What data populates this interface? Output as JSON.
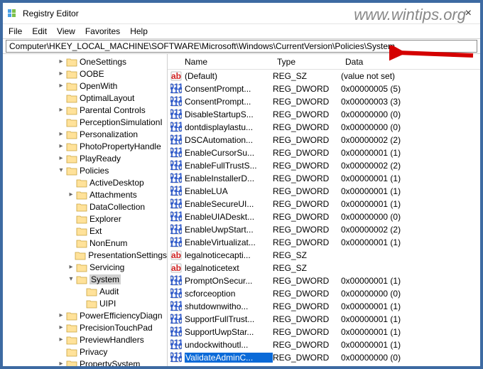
{
  "window": {
    "title": "Registry Editor",
    "watermark": "www.wintips.org"
  },
  "menu": {
    "file": "File",
    "edit": "Edit",
    "view": "View",
    "favorites": "Favorites",
    "help": "Help"
  },
  "address": {
    "value": "Computer\\HKEY_LOCAL_MACHINE\\SOFTWARE\\Microsoft\\Windows\\CurrentVersion\\Policies\\System"
  },
  "tree": {
    "items": [
      {
        "indent": 5,
        "twisty": ">",
        "label": "OneSettings"
      },
      {
        "indent": 5,
        "twisty": ">",
        "label": "OOBE"
      },
      {
        "indent": 5,
        "twisty": ">",
        "label": "OpenWith"
      },
      {
        "indent": 5,
        "twisty": "",
        "label": "OptimalLayout"
      },
      {
        "indent": 5,
        "twisty": ">",
        "label": "Parental Controls"
      },
      {
        "indent": 5,
        "twisty": "",
        "label": "PerceptionSimulationI"
      },
      {
        "indent": 5,
        "twisty": ">",
        "label": "Personalization"
      },
      {
        "indent": 5,
        "twisty": ">",
        "label": "PhotoPropertyHandle"
      },
      {
        "indent": 5,
        "twisty": ">",
        "label": "PlayReady"
      },
      {
        "indent": 5,
        "twisty": "v",
        "label": "Policies"
      },
      {
        "indent": 6,
        "twisty": "",
        "label": "ActiveDesktop"
      },
      {
        "indent": 6,
        "twisty": ">",
        "label": "Attachments"
      },
      {
        "indent": 6,
        "twisty": "",
        "label": "DataCollection"
      },
      {
        "indent": 6,
        "twisty": "",
        "label": "Explorer"
      },
      {
        "indent": 6,
        "twisty": "",
        "label": "Ext"
      },
      {
        "indent": 6,
        "twisty": "",
        "label": "NonEnum"
      },
      {
        "indent": 6,
        "twisty": "",
        "label": "PresentationSettings"
      },
      {
        "indent": 6,
        "twisty": ">",
        "label": "Servicing"
      },
      {
        "indent": 6,
        "twisty": "v",
        "label": "System",
        "selected": true
      },
      {
        "indent": 7,
        "twisty": "",
        "label": "Audit"
      },
      {
        "indent": 7,
        "twisty": "",
        "label": "UIPI"
      },
      {
        "indent": 5,
        "twisty": ">",
        "label": "PowerEfficiencyDiagn"
      },
      {
        "indent": 5,
        "twisty": ">",
        "label": "PrecisionTouchPad"
      },
      {
        "indent": 5,
        "twisty": ">",
        "label": "PreviewHandlers"
      },
      {
        "indent": 5,
        "twisty": "",
        "label": "Privacy"
      },
      {
        "indent": 5,
        "twisty": ">",
        "label": "PropertySystem"
      }
    ]
  },
  "columns": {
    "name": "Name",
    "type": "Type",
    "data": "Data"
  },
  "values": [
    {
      "icon": "sz",
      "name": "(Default)",
      "type": "REG_SZ",
      "data": "(value not set)"
    },
    {
      "icon": "dw",
      "name": "ConsentPrompt...",
      "type": "REG_DWORD",
      "data": "0x00000005 (5)"
    },
    {
      "icon": "dw",
      "name": "ConsentPrompt...",
      "type": "REG_DWORD",
      "data": "0x00000003 (3)"
    },
    {
      "icon": "dw",
      "name": "DisableStartupS...",
      "type": "REG_DWORD",
      "data": "0x00000000 (0)"
    },
    {
      "icon": "dw",
      "name": "dontdisplaylastu...",
      "type": "REG_DWORD",
      "data": "0x00000000 (0)"
    },
    {
      "icon": "dw",
      "name": "DSCAutomation...",
      "type": "REG_DWORD",
      "data": "0x00000002 (2)"
    },
    {
      "icon": "dw",
      "name": "EnableCursorSu...",
      "type": "REG_DWORD",
      "data": "0x00000001 (1)"
    },
    {
      "icon": "dw",
      "name": "EnableFullTrustS...",
      "type": "REG_DWORD",
      "data": "0x00000002 (2)"
    },
    {
      "icon": "dw",
      "name": "EnableInstallerD...",
      "type": "REG_DWORD",
      "data": "0x00000001 (1)"
    },
    {
      "icon": "dw",
      "name": "EnableLUA",
      "type": "REG_DWORD",
      "data": "0x00000001 (1)"
    },
    {
      "icon": "dw",
      "name": "EnableSecureUI...",
      "type": "REG_DWORD",
      "data": "0x00000001 (1)"
    },
    {
      "icon": "dw",
      "name": "EnableUIADeskt...",
      "type": "REG_DWORD",
      "data": "0x00000000 (0)"
    },
    {
      "icon": "dw",
      "name": "EnableUwpStart...",
      "type": "REG_DWORD",
      "data": "0x00000002 (2)"
    },
    {
      "icon": "dw",
      "name": "EnableVirtualizat...",
      "type": "REG_DWORD",
      "data": "0x00000001 (1)"
    },
    {
      "icon": "sz",
      "name": "legalnoticecapti...",
      "type": "REG_SZ",
      "data": ""
    },
    {
      "icon": "sz",
      "name": "legalnoticetext",
      "type": "REG_SZ",
      "data": ""
    },
    {
      "icon": "dw",
      "name": "PromptOnSecur...",
      "type": "REG_DWORD",
      "data": "0x00000001 (1)"
    },
    {
      "icon": "dw",
      "name": "scforceoption",
      "type": "REG_DWORD",
      "data": "0x00000000 (0)"
    },
    {
      "icon": "dw",
      "name": "shutdownwitho...",
      "type": "REG_DWORD",
      "data": "0x00000001 (1)"
    },
    {
      "icon": "dw",
      "name": "SupportFullTrust...",
      "type": "REG_DWORD",
      "data": "0x00000001 (1)"
    },
    {
      "icon": "dw",
      "name": "SupportUwpStar...",
      "type": "REG_DWORD",
      "data": "0x00000001 (1)"
    },
    {
      "icon": "dw",
      "name": "undockwithoutl...",
      "type": "REG_DWORD",
      "data": "0x00000001 (1)"
    },
    {
      "icon": "dw",
      "name": "ValidateAdminC...",
      "type": "REG_DWORD",
      "data": "0x00000000 (0)",
      "selected": true
    }
  ]
}
